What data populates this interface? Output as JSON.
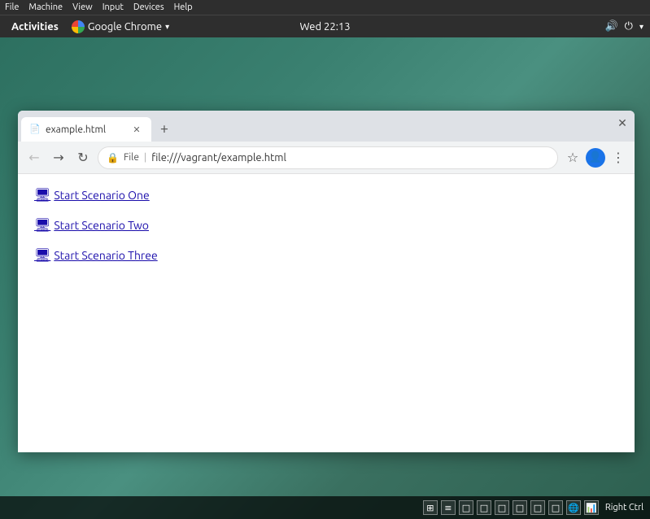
{
  "systemMenubar": {
    "items": [
      "File",
      "Machine",
      "View",
      "Input",
      "Devices",
      "Help"
    ],
    "devicesLabel": "Devices"
  },
  "gnomeBar": {
    "activitiesLabel": "Activities",
    "appLabel": "Google Chrome",
    "dropdownArrow": "▾",
    "clock": "Wed 22:13",
    "volumeIcon": "🔊",
    "powerIcon": "⏻"
  },
  "chromeWindow": {
    "closeBtn": "✕",
    "tab": {
      "favicon": "📄",
      "title": "example.html",
      "closeLabel": "✕"
    },
    "newTabLabel": "+",
    "addressBar": {
      "backBtn": "←",
      "forwardBtn": "→",
      "reloadBtn": "↻",
      "lockIcon": "🔒",
      "fileLabel": "File",
      "separator": "|",
      "url": "file:///vagrant/example.html",
      "starIcon": "☆",
      "menuIcon": "⋮"
    },
    "content": {
      "links": [
        {
          "icon": "🖥",
          "label": "Start Scenario One"
        },
        {
          "icon": "🖥",
          "label": "Start Scenario Two"
        },
        {
          "icon": "🖥",
          "label": "Start Scenario Three"
        }
      ]
    }
  },
  "taskbar": {
    "rightCtrlLabel": "Right Ctrl",
    "trayIcons": [
      "⊞",
      "≡",
      "□",
      "□",
      "□",
      "□",
      "□",
      "□",
      "🌐",
      "📊"
    ]
  }
}
